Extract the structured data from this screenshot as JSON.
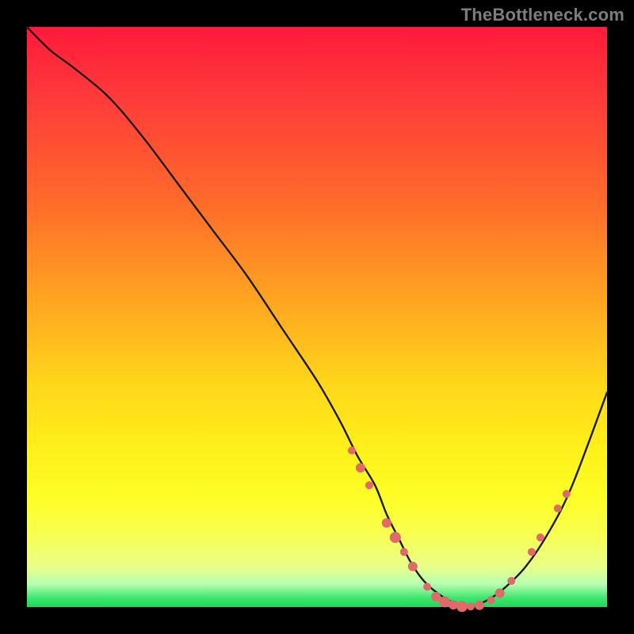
{
  "watermark": "TheBottleneck.com",
  "chart_data": {
    "type": "line",
    "title": "",
    "xlabel": "",
    "ylabel": "",
    "xlim": [
      0,
      100
    ],
    "ylim": [
      0,
      100
    ],
    "grid": false,
    "series": [
      {
        "name": "bottleneck-curve",
        "x": [
          0,
          4,
          8,
          14,
          20,
          26,
          32,
          38,
          44,
          50,
          54,
          57,
          60,
          62,
          64,
          66,
          68,
          70,
          73,
          76,
          79,
          82,
          86,
          90,
          94,
          100
        ],
        "y": [
          100,
          96,
          93,
          88,
          81,
          73,
          65,
          57,
          48,
          39,
          32,
          26,
          21,
          16,
          12,
          8,
          5,
          3,
          1,
          0,
          1,
          3,
          7,
          13,
          21,
          37
        ]
      }
    ],
    "markers": [
      {
        "x": 56,
        "y": 27,
        "r": 5
      },
      {
        "x": 57.5,
        "y": 24,
        "r": 6
      },
      {
        "x": 59,
        "y": 21,
        "r": 5
      },
      {
        "x": 62,
        "y": 14.5,
        "r": 6
      },
      {
        "x": 63.5,
        "y": 12,
        "r": 7
      },
      {
        "x": 65,
        "y": 9.5,
        "r": 5
      },
      {
        "x": 66.5,
        "y": 7,
        "r": 6
      },
      {
        "x": 69,
        "y": 3.5,
        "r": 5
      },
      {
        "x": 70.5,
        "y": 1.8,
        "r": 6
      },
      {
        "x": 72,
        "y": 0.9,
        "r": 7
      },
      {
        "x": 73.5,
        "y": 0.4,
        "r": 6
      },
      {
        "x": 75,
        "y": 0.1,
        "r": 7
      },
      {
        "x": 76.5,
        "y": 0.1,
        "r": 5
      },
      {
        "x": 78,
        "y": 0.3,
        "r": 6
      },
      {
        "x": 80,
        "y": 1.2,
        "r": 5
      },
      {
        "x": 81.5,
        "y": 2.4,
        "r": 6
      },
      {
        "x": 83.5,
        "y": 4.5,
        "r": 5
      },
      {
        "x": 87,
        "y": 9.5,
        "r": 5
      },
      {
        "x": 88.5,
        "y": 12,
        "r": 5
      },
      {
        "x": 91.5,
        "y": 17,
        "r": 5
      },
      {
        "x": 93,
        "y": 19.5,
        "r": 5
      }
    ]
  }
}
